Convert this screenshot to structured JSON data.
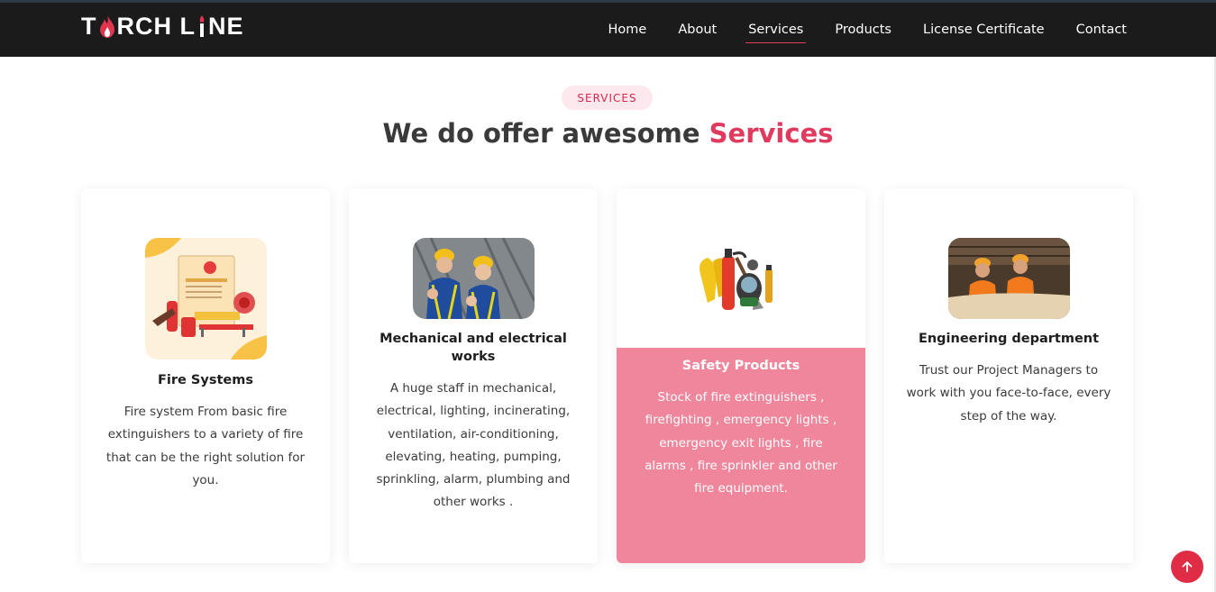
{
  "brand": {
    "logo_text_1": "T",
    "logo_text_2": "RCH L",
    "logo_text_3": "NE"
  },
  "nav": {
    "items": [
      "Home",
      "About",
      "Services",
      "Products",
      "License Certificate",
      "Contact"
    ],
    "active": "Services"
  },
  "section": {
    "badge": "SERVICES",
    "heading_main": "We do offer awesome ",
    "heading_accent": "Services"
  },
  "cards": [
    {
      "title": "Fire Systems",
      "text": "Fire system From basic fire extinguishers to a variety of fire that can be the right solution for you.",
      "icon": "fire-prevention-icon"
    },
    {
      "title": "Mechanical and electrical works",
      "text": "A huge staff in mechanical, electrical, lighting, incinerating, ventilation, air-conditioning, elevating, heating, pumping, sprinkling, alarm, plumbing and other works .",
      "icon": "workers-photo"
    },
    {
      "title": "Safety Products",
      "text": "Stock of fire extinguishers , firefighting , emergency lights , emergency exit lights , fire alarms , fire sprinkler and other fire equipment.",
      "icon": "safety-equipment-icon"
    },
    {
      "title": "Engineering department",
      "text": "Trust our Project Managers to work with you face-to-face, every step of the way.",
      "icon": "engineers-photo"
    }
  ],
  "colors": {
    "accent": "#e03a5e",
    "navbar": "#1b1b1b",
    "highlight_card": "#ef869c"
  },
  "back_to_top_icon": "arrow-up-icon"
}
